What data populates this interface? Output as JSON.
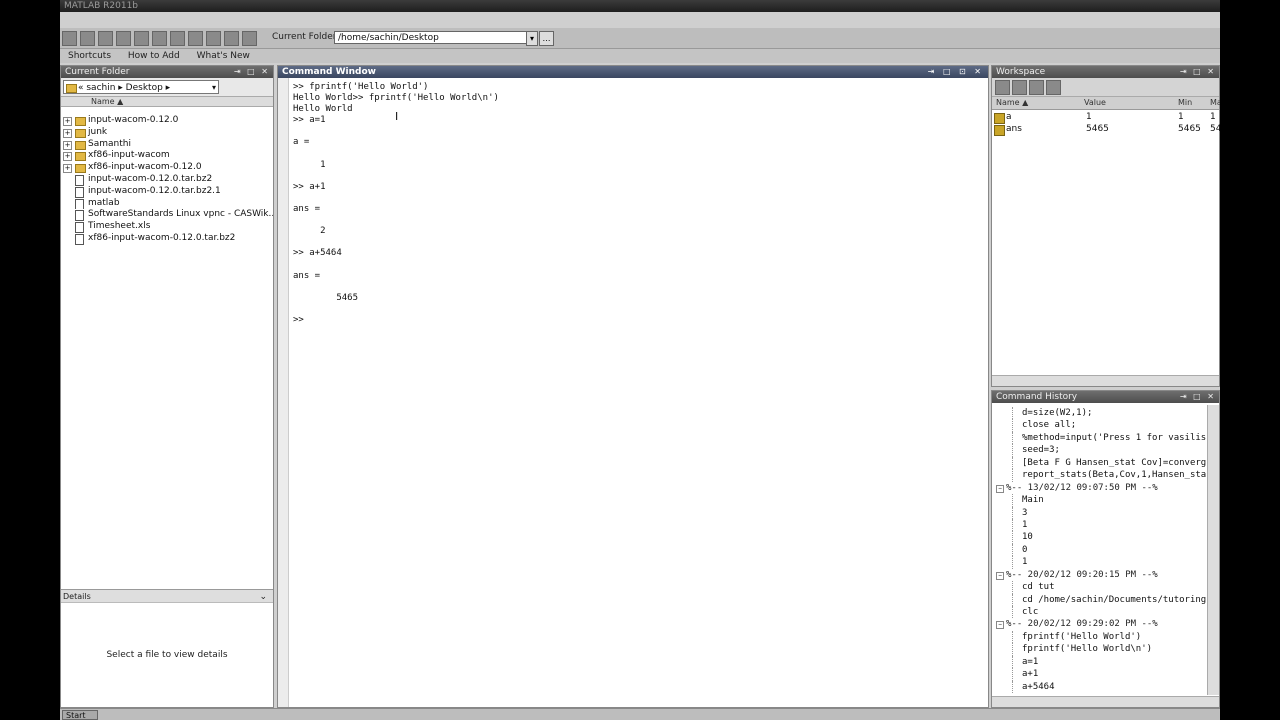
{
  "app": {
    "title": "MATLAB R2011b"
  },
  "toolbar": {
    "current_folder_label": "Current Folder:",
    "current_folder_value": "/home/sachin/Desktop",
    "dropdown_glyph": "▾",
    "browse_glyph": "…"
  },
  "shortcuts": {
    "items": [
      "Shortcuts",
      "How to Add",
      "What's New"
    ]
  },
  "left_panel": {
    "title": "Current Folder",
    "address": "« sachin ▸ Desktop ▸",
    "name_header": "Name ▲",
    "files": [
      {
        "name": "input-wacom-0.12.0",
        "type": "folder"
      },
      {
        "name": "junk",
        "type": "folder"
      },
      {
        "name": "Samanthi",
        "type": "folder"
      },
      {
        "name": "xf86-input-wacom",
        "type": "folder"
      },
      {
        "name": "xf86-input-wacom-0.12.0",
        "type": "folder"
      },
      {
        "name": "input-wacom-0.12.0.tar.bz2",
        "type": "file"
      },
      {
        "name": "input-wacom-0.12.0.tar.bz2.1",
        "type": "file"
      },
      {
        "name": "matlab",
        "type": "file"
      },
      {
        "name": "SoftwareStandards Linux vpnc - CASWik...",
        "type": "file"
      },
      {
        "name": "Timesheet.xls",
        "type": "file"
      },
      {
        "name": "xf86-input-wacom-0.12.0.tar.bz2",
        "type": "file"
      }
    ],
    "details_label": "Details",
    "details_message": "Select a file to view details"
  },
  "command_window": {
    "title": "Command Window",
    "lines": [
      ">> fprintf('Hello World')",
      "Hello World>> fprintf('Hello World\\n')",
      "Hello World",
      ">> a=1",
      "",
      "a =",
      "",
      "     1",
      "",
      ">> a+1",
      "",
      "ans =",
      "",
      "     2",
      "",
      ">> a+5464",
      "",
      "ans =",
      "",
      "        5465",
      "",
      ">>"
    ]
  },
  "workspace": {
    "title": "Workspace",
    "columns": [
      "Name ▲",
      "Value",
      "Min",
      "Max"
    ],
    "rows": [
      {
        "name": "a",
        "value": "1",
        "min": "1",
        "max": "1"
      },
      {
        "name": "ans",
        "value": "5465",
        "min": "5465",
        "max": "54"
      }
    ]
  },
  "history": {
    "title": "Command History",
    "lines": [
      {
        "kind": "cmd",
        "text": "d=size(W2,1);"
      },
      {
        "kind": "cmd",
        "text": "close all;"
      },
      {
        "kind": "cmd",
        "text": "%method=input('Press 1 for vasilis"
      },
      {
        "kind": "cmd",
        "text": "seed=3;"
      },
      {
        "kind": "cmd",
        "text": "[Beta F G Hansen_stat Cov]=converg"
      },
      {
        "kind": "cmd",
        "text": "report_stats(Beta,Cov,1,Hansen_sta"
      },
      {
        "kind": "stamp",
        "text": "%-- 13/02/12 09:07:50 PM --%"
      },
      {
        "kind": "cmd",
        "text": "Main"
      },
      {
        "kind": "cmd",
        "text": "3"
      },
      {
        "kind": "cmd",
        "text": "1"
      },
      {
        "kind": "cmd",
        "text": "10"
      },
      {
        "kind": "cmd",
        "text": "0"
      },
      {
        "kind": "cmd",
        "text": "1"
      },
      {
        "kind": "stamp",
        "text": "%-- 20/02/12 09:20:15 PM --%"
      },
      {
        "kind": "cmd",
        "text": "cd tut"
      },
      {
        "kind": "cmd",
        "text": "cd /home/sachin/Documents/tutoring"
      },
      {
        "kind": "cmd",
        "text": "clc"
      },
      {
        "kind": "stamp",
        "text": "%-- 20/02/12 09:29:02 PM --%"
      },
      {
        "kind": "cmd",
        "text": "fprintf('Hello World')"
      },
      {
        "kind": "cmd",
        "text": "fprintf('Hello World\\n')"
      },
      {
        "kind": "cmd",
        "text": "a=1"
      },
      {
        "kind": "cmd",
        "text": "a+1"
      },
      {
        "kind": "cmd",
        "text": "a+5464"
      }
    ]
  },
  "statusbar": {
    "start_label": "Start"
  },
  "icons": {
    "folder": "folder-icon",
    "file": "file-icon",
    "variable": "variable-icon",
    "expand": "expand-icon"
  },
  "colors": {
    "title_bar": "#3a4660",
    "folder": "#e2b844",
    "variable": "#c9a528"
  }
}
